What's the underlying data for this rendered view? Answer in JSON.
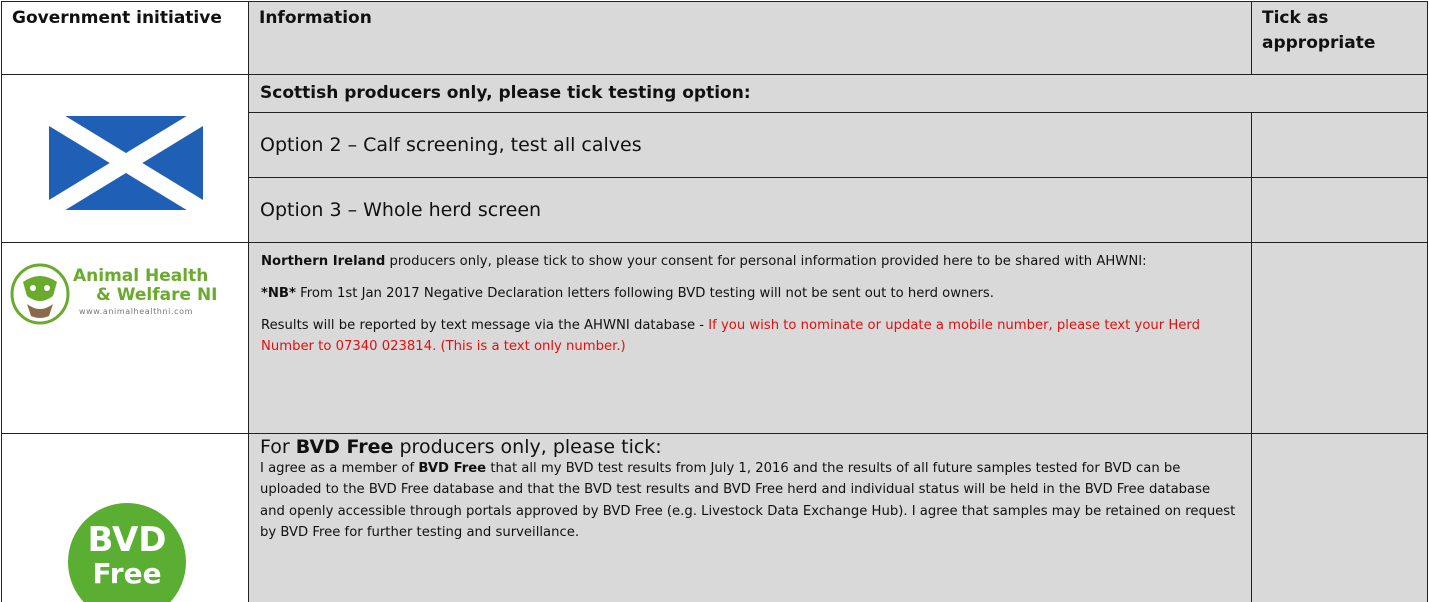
{
  "header": {
    "col1": "Government initiative",
    "col2": "Information",
    "col3": "Tick as appropriate"
  },
  "scotland": {
    "subheader": "Scottish producers only, please tick testing option:",
    "option2": "Option 2 – Calf screening, test all calves",
    "option3": "Option 3 – Whole herd screen",
    "flag_colors": {
      "blue": "#1f5fb5",
      "white": "#ffffff"
    }
  },
  "northern_ireland": {
    "logo": {
      "line1": "Animal Health",
      "line2": "& Welfare NI",
      "url": "www.animalhealthni.com",
      "color": "#6aab2e"
    },
    "p1_bold": "Northern Ireland",
    "p1_rest": " producers only, please tick to show your consent for personal information provided here to be shared with AHWNI:",
    "p2_bold": "*NB*",
    "p2_rest": " From 1st Jan 2017 Negative Declaration letters following BVD testing will not be sent out to herd owners.",
    "p3_black": "Results will be reported by text message via the AHWNI database - ",
    "p3_red": "If you wish to nominate or update a mobile number, please text your Herd Number to 07340 023814. (This is a text only number.)"
  },
  "bvd_free": {
    "logo": {
      "line1": "BVD",
      "line2": "Free",
      "color": "#5aae32"
    },
    "title_pre": "For ",
    "title_bold": "BVD Free",
    "title_post": " producers only, please tick:",
    "t1": "I agree as a member of ",
    "t2": "BVD Free",
    "t3": " that all my BVD test results from July 1, 2016 and the results of all future samples tested for BVD can be uploaded to the BVD Free database and that the BVD test results and BVD Free herd and individual status will be held in the BVD Free database and openly accessible through portals approved by BVD Free (e.g. Livestock Data Exchange Hub). I agree that samples may be retained on request by BVD Free for further testing and surveillance."
  }
}
